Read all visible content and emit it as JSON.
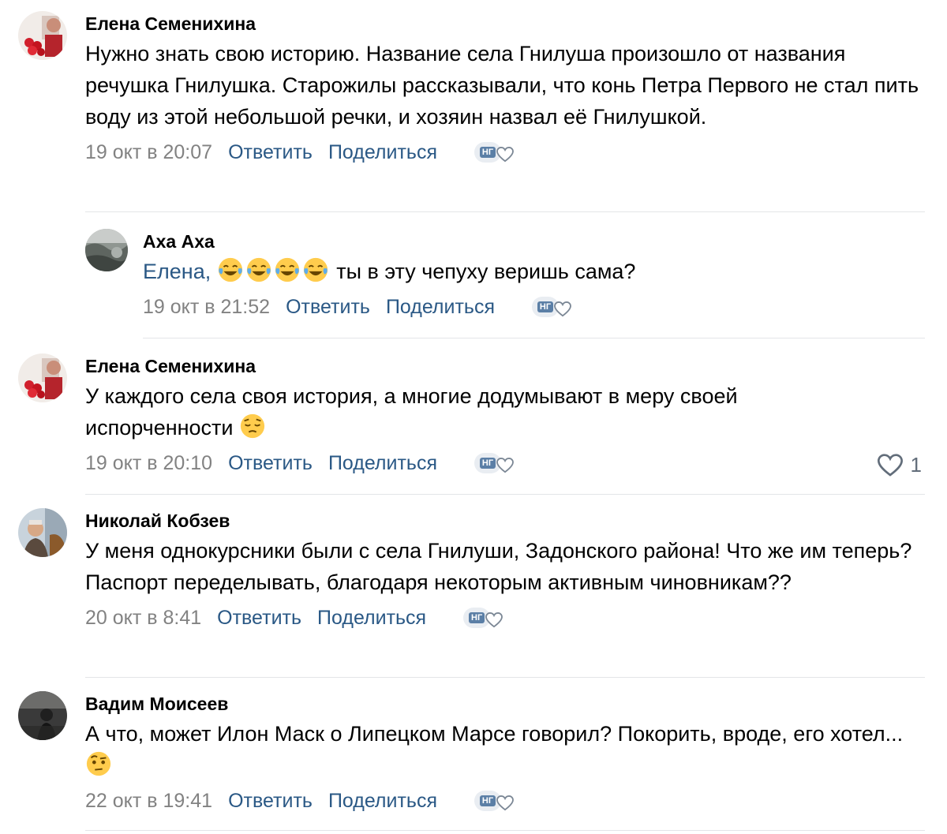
{
  "comments": [
    {
      "author": "Елена Семенихина",
      "text": "Нужно знать свою историю. Название села Гнилуша произошло от названия речушка Гнилушка. Старожилы рассказывали, что конь Петра Первого не стал пить воду из этой небольшой речки, и хозяин назвал её Гнилушкой.",
      "date": "19 окт в 20:07",
      "reply_label": "Ответить",
      "share_label": "Поделиться",
      "avatar_icon": "avatar-roses"
    },
    {
      "author": "Аха Аха",
      "mention": "Елена,",
      "emoji": [
        "face-with-tears-of-joy",
        "face-with-tears-of-joy",
        "face-with-tears-of-joy",
        "face-with-tears-of-joy"
      ],
      "text": "ты в эту чепуху веришь сама?",
      "date": "19 окт в 21:52",
      "reply_label": "Ответить",
      "share_label": "Поделиться",
      "avatar_icon": "avatar-landscape"
    },
    {
      "author": "Елена Семенихина",
      "text": "У каждого села своя история, а многие додумывают в меру своей испорченности",
      "emoji": [
        "pensive-face"
      ],
      "date": "19 окт в 20:10",
      "reply_label": "Ответить",
      "share_label": "Поделиться",
      "like_count": "1",
      "avatar_icon": "avatar-roses"
    },
    {
      "author": "Николай Кобзев",
      "text": "У меня однокурсники были с села Гнилуши, Задонского района! Что же им теперь? Паспорт переделывать, благодаря некоторым активным чиновникам??",
      "date": "20 окт в 8:41",
      "reply_label": "Ответить",
      "share_label": "Поделиться",
      "avatar_icon": "avatar-man"
    },
    {
      "author": "Вадим Моисеев",
      "text": "А что, может Илон Маск о Липецком Марсе говорил? Покорить, вроде, его хотел...",
      "emoji": [
        "face-with-raised-eyebrow"
      ],
      "date": "22 окт в 19:41",
      "reply_label": "Ответить",
      "share_label": "Поделиться",
      "avatar_icon": "avatar-dark"
    }
  ],
  "reaction_badge_text": "НГ",
  "colors": {
    "link": "#2a5885",
    "date": "#828282",
    "divider": "#e3e5e8"
  }
}
